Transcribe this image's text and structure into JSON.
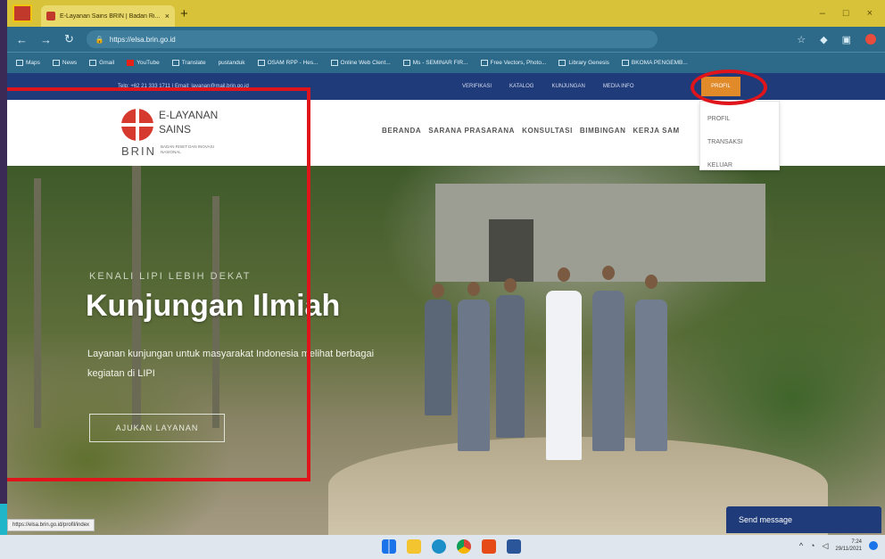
{
  "browser": {
    "tab_title": "E-Layanan Sains BRIN | Badan Ri...",
    "tab_close": "×",
    "new_tab": "+",
    "url": "https://elsa.brin.go.id",
    "window_controls": [
      "–",
      "□",
      "×"
    ],
    "bookmarks": [
      "Maps",
      "News",
      "Gmail",
      "YouTube",
      "Translate",
      "pustanduk",
      "OSAM RPP - Hes...",
      "Online Web Clent...",
      "Ms - SEMINAR FIR...",
      "Free Vectors, Photo...",
      "Library Genesis",
      "BKOMA PENGEMB..."
    ]
  },
  "site": {
    "topbar_contact": "Telp: +62 21 333 1711 | Email: layanan@mail.brin.go.id",
    "topbar_nav": [
      "VERIFIKASI",
      "KATALOG",
      "KUNJUNGAN",
      "MEDIA INFO"
    ],
    "profil_button": "PROFIL",
    "logo_line1": "E-LAYANAN",
    "logo_line2": "SAINS",
    "logo_brin": "BRIN",
    "logo_sub": "BADAN RISET DAN INOVASI NASIONAL",
    "main_nav": [
      "BERANDA",
      "SARANA PRASARANA",
      "KONSULTASI",
      "BIMBINGAN",
      "KERJA SAM"
    ],
    "dropdown": [
      "PROFIL",
      "TRANSAKSI",
      "KELUAR"
    ],
    "hero_kicker": "KENALI LIPI LEBIH DEKAT",
    "hero_title": "Kunjungan Ilmiah",
    "hero_desc": "Layanan kunjungan untuk masyarakat Indonesia melihat berbagai kegiatan di LIPI",
    "hero_button": "AJUKAN LAYANAN",
    "send_message": "Send message"
  },
  "status_bar_url": "https://elsa.brin.go.id/profil/index",
  "taskbar": {
    "time": "7:24",
    "date": "29/11/2021"
  },
  "colors": {
    "titlebar": "#d8c23a",
    "addressbar": "#2d6a8a",
    "site_nav": "#1f3b79",
    "profil_accent": "#e08a2a",
    "annotation_red": "#e0141b"
  }
}
